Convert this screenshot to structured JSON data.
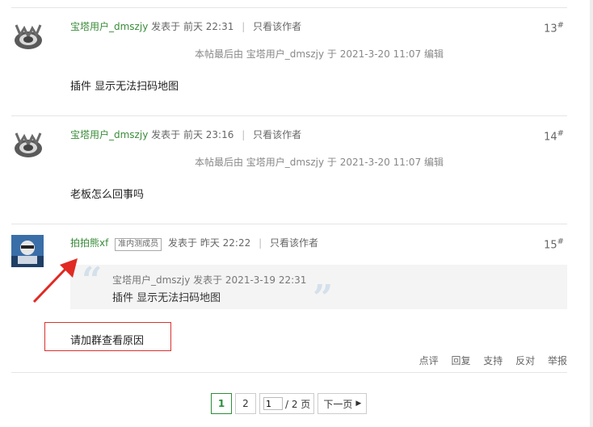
{
  "posts": [
    {
      "user": "宝塔用户_dmszjy",
      "posted_label": "发表于",
      "posted_time": "前天 22:31",
      "only_author": "只看该作者",
      "floor": "13",
      "edited": "本帖最后由 宝塔用户_dmszjy 于 2021-3-20 11:07 编辑",
      "content": "插件 显示无法扫码地图"
    },
    {
      "user": "宝塔用户_dmszjy",
      "posted_label": "发表于",
      "posted_time": "前天 23:16",
      "only_author": "只看该作者",
      "floor": "14",
      "edited": "本帖最后由 宝塔用户_dmszjy 于 2021-3-20 11:07 编辑",
      "content": "老板怎么回事吗"
    },
    {
      "user": "拍拍熊xf",
      "tag": "准内测成员",
      "posted_label": "发表于",
      "posted_time": "昨天 22:22",
      "only_author": "只看该作者",
      "floor": "15",
      "quote_header": "宝塔用户_dmszjy 发表于 2021-3-19 22:31",
      "quote_body": "插件 显示无法扫码地图",
      "content": "请加群查看原因",
      "actions": [
        "点评",
        "回复",
        "支持",
        "反对",
        "举报"
      ]
    }
  ],
  "floor_mark": "#",
  "pagination": {
    "pages": [
      "1",
      "2"
    ],
    "current": "1",
    "input_value": "1",
    "total": "/ 2 页",
    "next": "下一页"
  },
  "colors": {
    "username": "#3a8c3a",
    "annotation": "#d9322e",
    "current_page": "#2a8f3a"
  }
}
